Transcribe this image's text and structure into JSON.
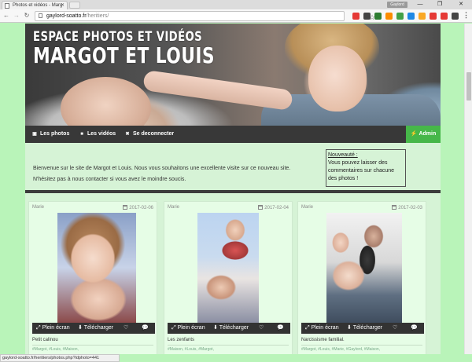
{
  "browser": {
    "tab_title": "Photos et vidéos - Marg",
    "profile": "Gaylord",
    "url_host": "gaylord-soatto.fr",
    "url_path": "/heritiers/",
    "status_url": "gaylord-soatto.fr/heritiers/photos.php?idphoto=441",
    "window_controls": {
      "minimize": "—",
      "maximize": "❐",
      "close": "✕"
    },
    "nav": {
      "back": "←",
      "forward": "→",
      "reload": "↻"
    },
    "extension_colors": [
      "#e53935",
      "#444444",
      "#2e7d32",
      "#fb8c00",
      "#43a047",
      "#1e88e5",
      "#f9a825",
      "#e53935"
    ]
  },
  "banner": {
    "line1": "Espace photos et vidéos",
    "line2": "Margot et Louis"
  },
  "nav": {
    "photos": "Les photos",
    "videos": "Les vidéos",
    "logout": "Se deconnecter",
    "admin": "Admin",
    "photos_icon": "camera-icon",
    "videos_icon": "video-icon",
    "logout_icon": "logout-icon",
    "admin_icon": "bolt-icon"
  },
  "welcome": {
    "line1": "Bienvenue sur le site de Margot et Louis. Nous vous souhaitons une excellente visite sur ce nouveau site.",
    "line2": "N'hésitez pas à nous contacter si vous avez le moindre soucis."
  },
  "notice": {
    "title": "Nouveauté :",
    "text": "Vous pouvez laisser des commentaires sur chacune des photos !"
  },
  "actions": {
    "fullscreen": "Plein écran",
    "download": "Télécharger",
    "like_icon": "heart-icon",
    "comment_icon": "comment-icon"
  },
  "cards": [
    {
      "author": "Marie",
      "date": "2017-02-06",
      "caption": "Petit calinou",
      "tags": "#Margot, #Louis, #Maison,"
    },
    {
      "author": "Marie",
      "date": "2017-02-04",
      "caption": "Les zenfants",
      "tags": "#Maison, #Louis, #Margot,"
    },
    {
      "author": "Marie",
      "date": "2017-02-03",
      "caption": "Narcissisme familial.",
      "tags": "#Margot, #Louis, #Marie, #Gaylord, #Maison,"
    }
  ],
  "colors": {
    "page_bg": "#b9f4b9",
    "container_bg": "#d6f3d6",
    "navbar_bg": "#383838",
    "admin_bg": "#46b749",
    "card_bg": "#e6fde6"
  }
}
